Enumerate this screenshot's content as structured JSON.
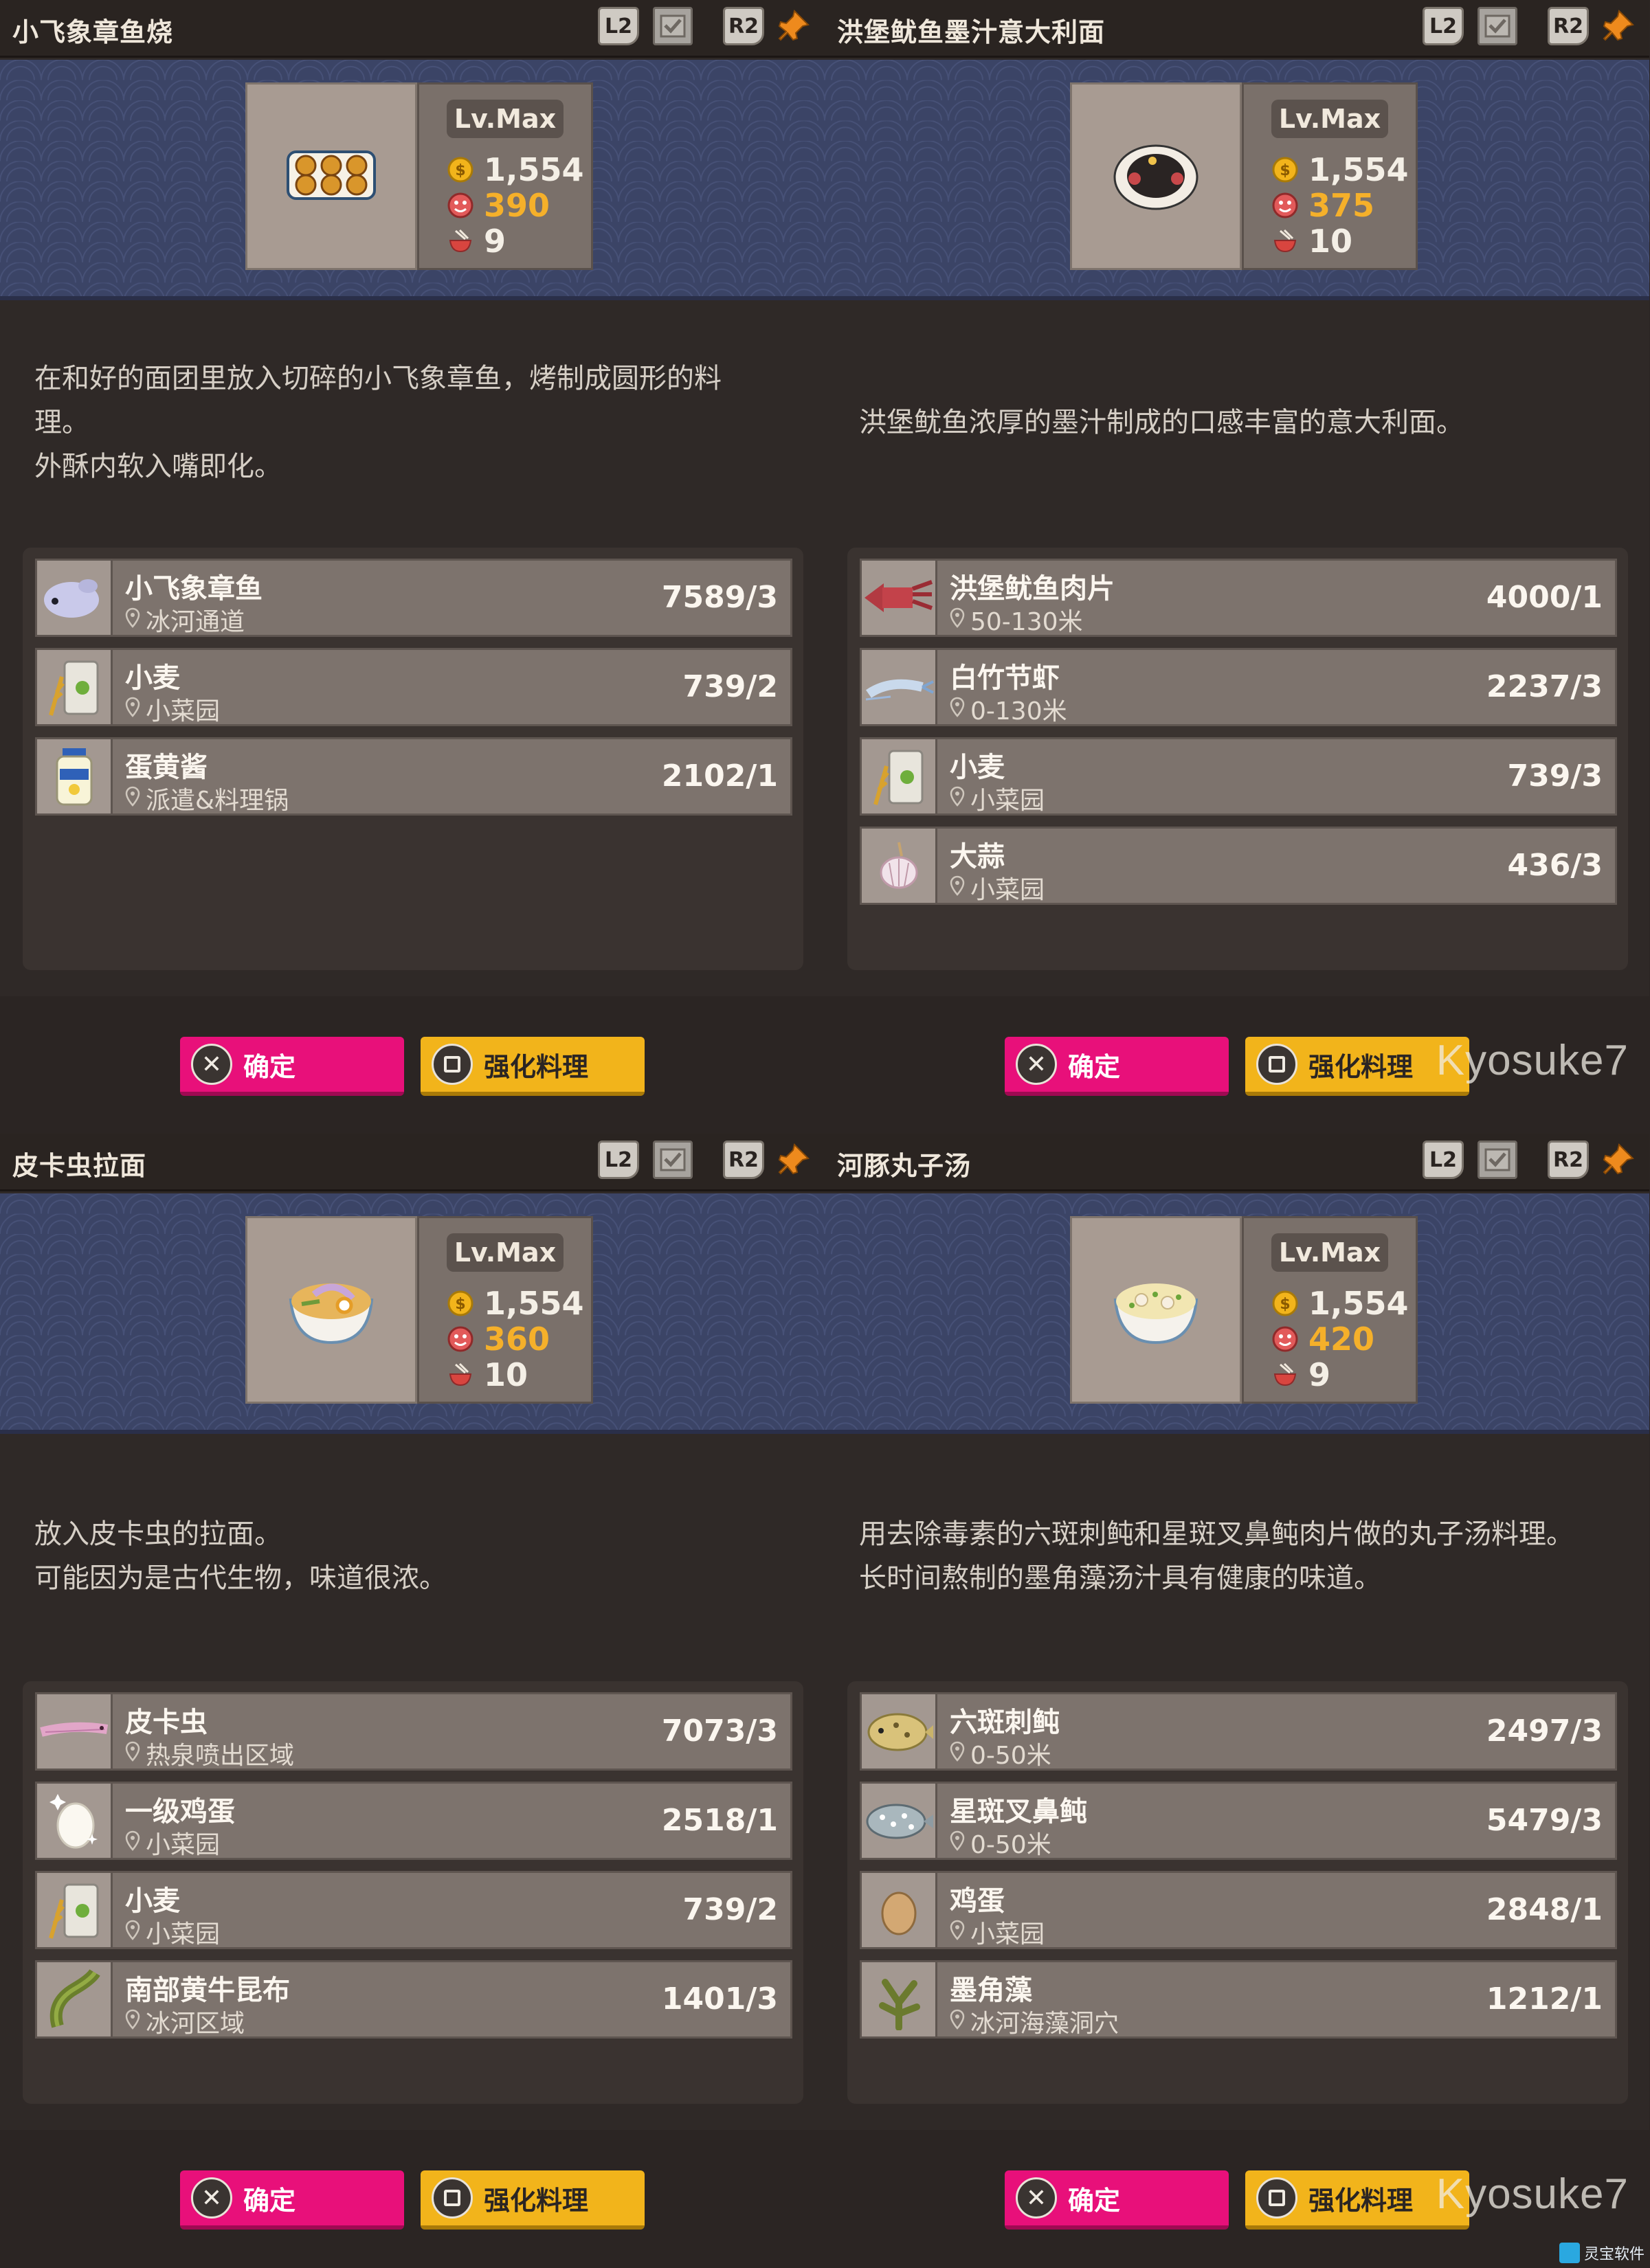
{
  "panels": [
    {
      "title": "小飞象章鱼烧",
      "controls": {
        "l2": "L2",
        "r2": "R2"
      },
      "dish_icon": "takoyaki-icon",
      "level": "Lv.Max",
      "price": "1,554",
      "taste": "390",
      "servings": "9",
      "description": [
        "在和好的面团里放入切碎的小飞象章鱼，烤制成圆形的料",
        "理。",
        "外酥内软入嘴即化。"
      ],
      "ingredients": [
        {
          "name": "小飞象章鱼",
          "location": "冰河通道",
          "count": "7589/3",
          "icon": "dumbo-octopus-icon"
        },
        {
          "name": "小麦",
          "location": "小菜园",
          "count": "739/2",
          "icon": "wheat-sack-icon"
        },
        {
          "name": "蛋黄酱",
          "location": "派遣&料理锅",
          "count": "2102/1",
          "icon": "mayonnaise-icon"
        }
      ],
      "confirm_label": "确定",
      "enhance_label": "强化料理",
      "watermark": ""
    },
    {
      "title": "洪堡鱿鱼墨汁意大利面",
      "controls": {
        "l2": "L2",
        "r2": "R2"
      },
      "dish_icon": "squid-ink-pasta-icon",
      "level": "Lv.Max",
      "price": "1,554",
      "taste": "375",
      "servings": "10",
      "description": [
        "洪堡鱿鱼浓厚的墨汁制成的口感丰富的意大利面。"
      ],
      "ingredients": [
        {
          "name": "洪堡鱿鱼肉片",
          "location": "50-130米",
          "count": "4000/1",
          "icon": "squid-icon"
        },
        {
          "name": "白竹节虾",
          "location": "0-130米",
          "count": "2237/3",
          "icon": "shrimp-icon"
        },
        {
          "name": "小麦",
          "location": "小菜园",
          "count": "739/3",
          "icon": "wheat-sack-icon"
        },
        {
          "name": "大蒜",
          "location": "小菜园",
          "count": "436/3",
          "icon": "garlic-icon"
        }
      ],
      "confirm_label": "确定",
      "enhance_label": "强化料理",
      "watermark": "Kyosuke7"
    },
    {
      "title": "皮卡虫拉面",
      "controls": {
        "l2": "L2",
        "r2": "R2"
      },
      "dish_icon": "ramen-icon",
      "level": "Lv.Max",
      "price": "1,554",
      "taste": "360",
      "servings": "10",
      "description": [
        "放入皮卡虫的拉面。",
        "可能因为是古代生物，味道很浓。"
      ],
      "ingredients": [
        {
          "name": "皮卡虫",
          "location": "热泉喷出区域",
          "count": "7073/3",
          "icon": "pikaia-icon"
        },
        {
          "name": "一级鸡蛋",
          "location": "小菜园",
          "count": "2518/1",
          "icon": "premium-egg-icon"
        },
        {
          "name": "小麦",
          "location": "小菜园",
          "count": "739/2",
          "icon": "wheat-sack-icon"
        },
        {
          "name": "南部黄牛昆布",
          "location": "冰河区域",
          "count": "1401/3",
          "icon": "kelp-icon"
        }
      ],
      "confirm_label": "确定",
      "enhance_label": "强化料理",
      "watermark": ""
    },
    {
      "title": "河豚丸子汤",
      "controls": {
        "l2": "L2",
        "r2": "R2"
      },
      "dish_icon": "pufferfish-soup-icon",
      "level": "Lv.Max",
      "price": "1,554",
      "taste": "420",
      "servings": "9",
      "description": [
        "用去除毒素的六斑刺鲀和星斑叉鼻鲀肉片做的丸子汤料理。",
        "长时间熬制的墨角藻汤汁具有健康的味道。"
      ],
      "ingredients": [
        {
          "name": "六斑刺鲀",
          "location": "0-50米",
          "count": "2497/3",
          "icon": "porcupinefish-icon"
        },
        {
          "name": "星斑叉鼻鲀",
          "location": "0-50米",
          "count": "5479/3",
          "icon": "starry-puffer-icon"
        },
        {
          "name": "鸡蛋",
          "location": "小菜园",
          "count": "2848/1",
          "icon": "egg-icon"
        },
        {
          "name": "墨角藻",
          "location": "冰河海藻洞穴",
          "count": "1212/1",
          "icon": "seaweed-icon"
        }
      ],
      "confirm_label": "确定",
      "enhance_label": "强化料理",
      "watermark": "Kyosuke7"
    }
  ],
  "brand": "灵宝软件",
  "colors": {
    "confirm": "#e8107a",
    "enhance": "#f2b41b",
    "taste_value": "#f5b02a",
    "hero_bg": "#3b4466"
  }
}
